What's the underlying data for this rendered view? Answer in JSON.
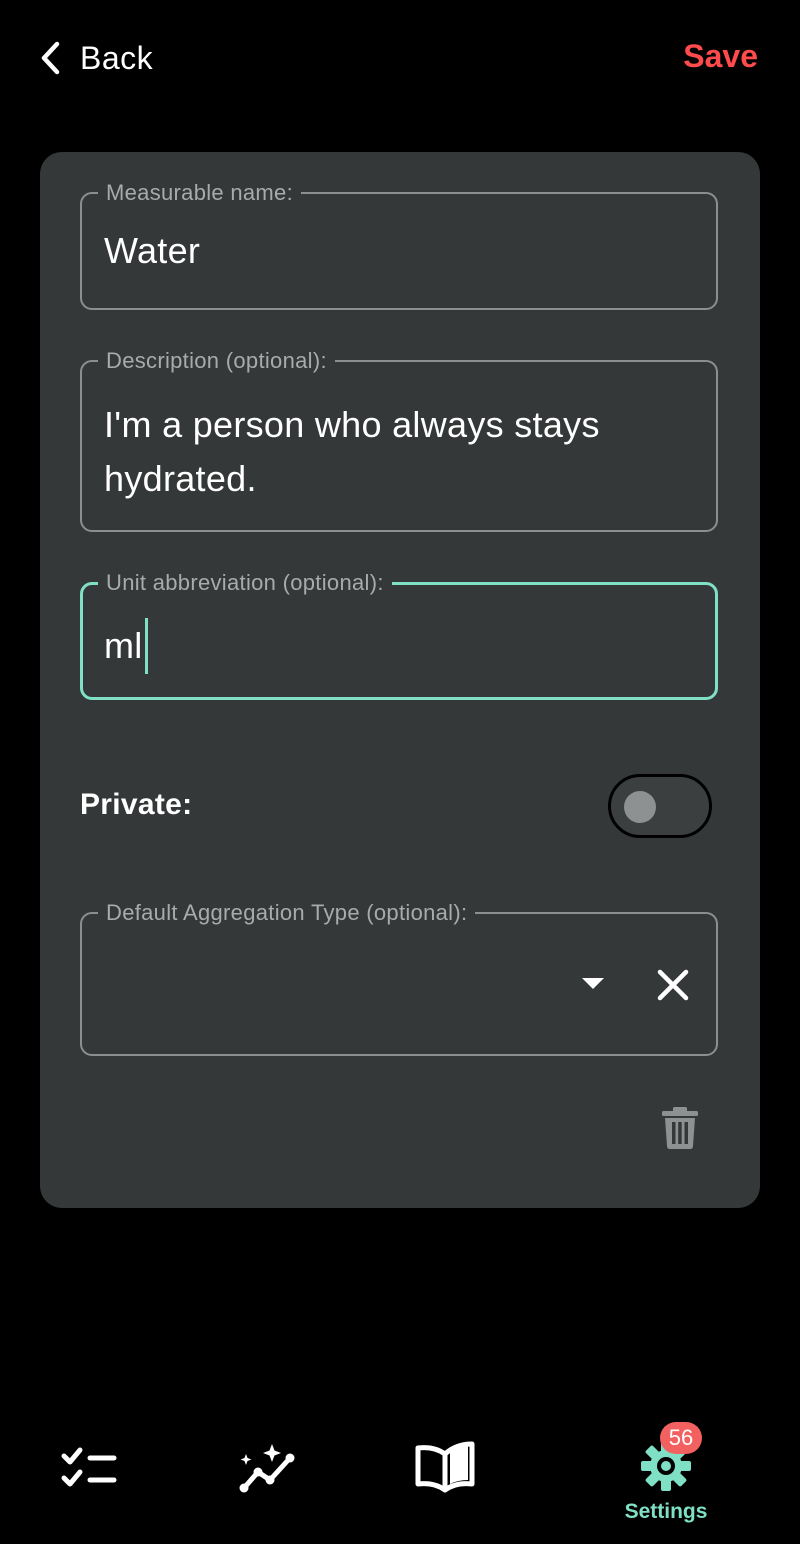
{
  "header": {
    "back_label": "Back",
    "save_label": "Save"
  },
  "form": {
    "name_field": {
      "label": "Measurable name:",
      "value": "Water"
    },
    "description_field": {
      "label": "Description (optional):",
      "value": "I'm a person who always stays hydrated."
    },
    "unit_field": {
      "label": "Unit abbreviation (optional):",
      "value": "ml",
      "focused": true
    },
    "private_toggle": {
      "label": "Private:",
      "on": false
    },
    "aggregation_field": {
      "label": "Default Aggregation Type (optional):",
      "value": ""
    }
  },
  "bottom_nav": {
    "items": [
      {
        "icon": "checklist-icon",
        "label": ""
      },
      {
        "icon": "sparkle-chart-icon",
        "label": ""
      },
      {
        "icon": "open-book-icon",
        "label": ""
      },
      {
        "icon": "gear-icon",
        "label": "Settings",
        "badge": "56",
        "active": true
      }
    ]
  },
  "colors": {
    "background": "#000000",
    "card": "#353838",
    "accent": "#7fe0c5",
    "save": "#ff4b4b",
    "badge": "#f26060",
    "field_border": "#8c8f8f"
  }
}
